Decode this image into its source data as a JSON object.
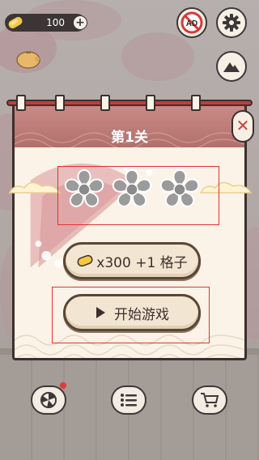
{
  "hud": {
    "coins": "100",
    "coin_plus_label": "+",
    "noad_label": "AD",
    "icons": [
      "coin-icon",
      "no-ad-icon",
      "gear-icon",
      "mountain-icon",
      "piggy-bank-icon"
    ]
  },
  "modal": {
    "title": "第1关",
    "stars_earned": 0,
    "stars_total": 3,
    "reward_label": "x300 +1 格子",
    "start_label": "开始游戏",
    "close_label": "✕"
  },
  "bottom_bar": {
    "icons": [
      "wheel-icon",
      "list-icon",
      "cart-icon"
    ]
  },
  "colors": {
    "header": "#c17d79",
    "panel": "#fbf3e7",
    "button": "#f2e6d2",
    "outline": "#3d2f2c",
    "highlight_box": "#e23232"
  }
}
